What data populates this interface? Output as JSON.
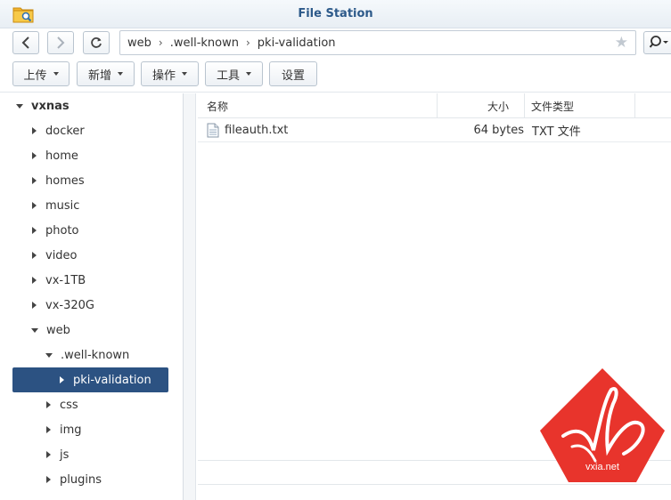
{
  "window": {
    "title": "File Station"
  },
  "path": {
    "crumbs": [
      "web",
      ".well-known",
      "pki-validation"
    ]
  },
  "toolbar": {
    "upload": "上传",
    "create": "新增",
    "action": "操作",
    "tools": "工具",
    "settings": "设置"
  },
  "tree": {
    "root": "vxnas",
    "items": [
      "docker",
      "home",
      "homes",
      "music",
      "photo",
      "video",
      "vx-1TB",
      "vx-320G",
      "web"
    ],
    "web_children": {
      "well_known": ".well-known",
      "selected": "pki-validation",
      "others": [
        "css",
        "img",
        "js",
        "plugins"
      ]
    }
  },
  "list": {
    "columns": {
      "name": "名称",
      "size": "大小",
      "type": "文件类型"
    },
    "rows": [
      {
        "name": "fileauth.txt",
        "size": "64 bytes",
        "type": "TXT 文件"
      }
    ]
  },
  "watermark": {
    "text": "vxia.net",
    "color": "#e8342c"
  }
}
